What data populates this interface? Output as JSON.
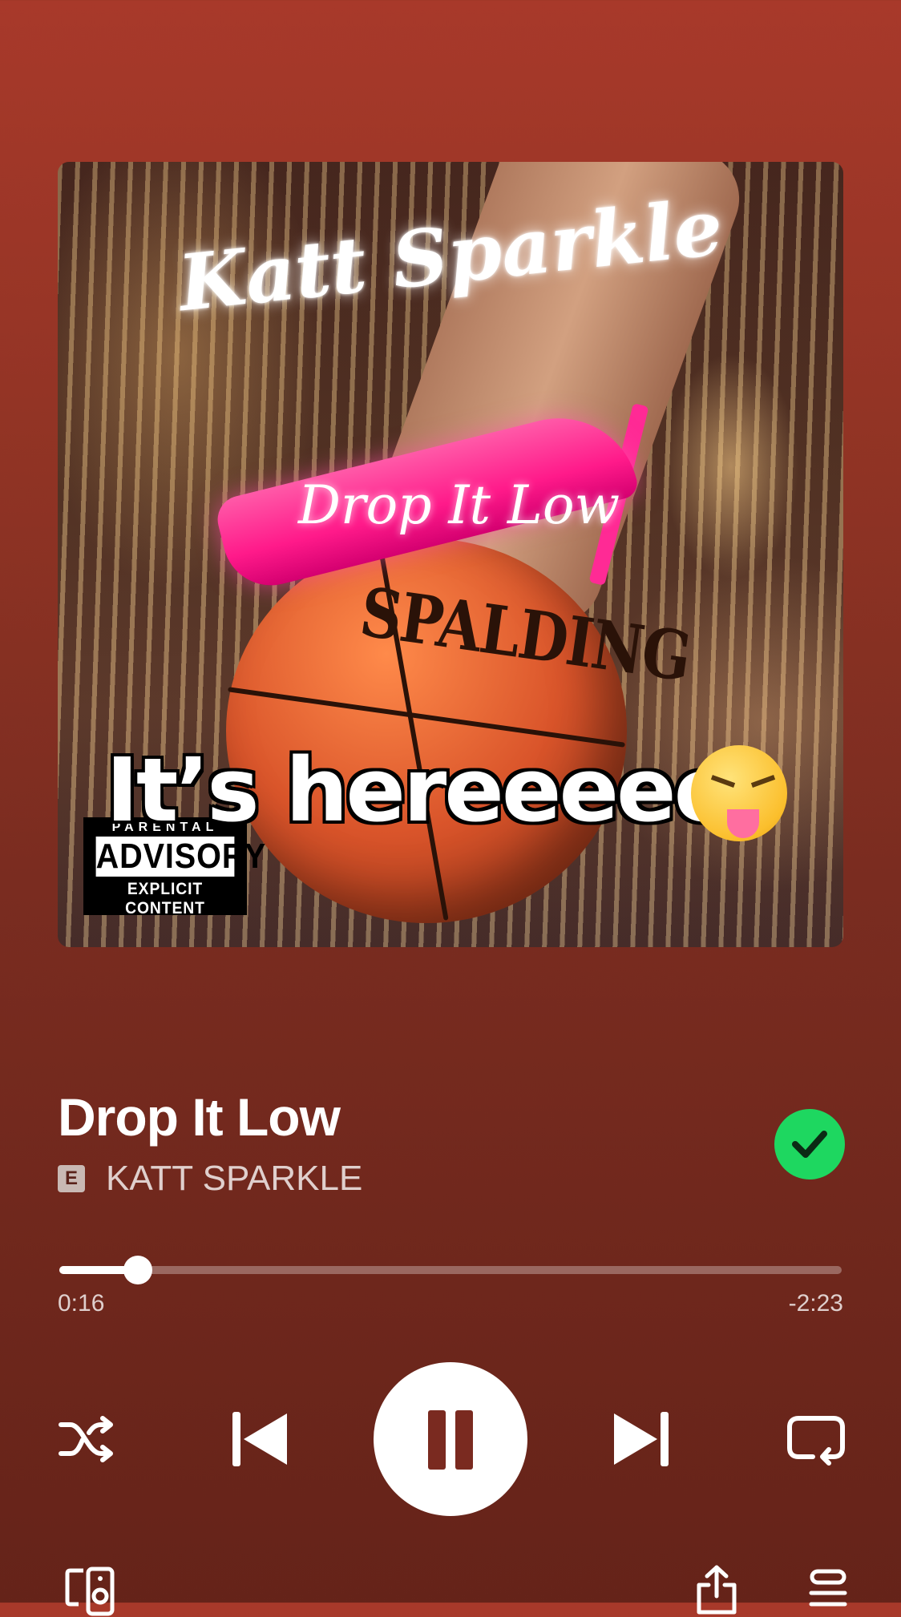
{
  "header": {
    "title": "",
    "back_icon": "chevron-down-icon"
  },
  "album_art": {
    "artist_lettering": "Katt Sparkle",
    "song_lettering": "Drop It Low",
    "ball_brand": "SPALDING",
    "overlay_caption": "It’s hereeeee",
    "overlay_emoji": "squinting-face-with-tongue",
    "advisory": {
      "top": "PARENTAL",
      "middle": "ADVISORY",
      "bottom": "EXPLICIT CONTENT"
    }
  },
  "track": {
    "title": "Drop It Low",
    "explicit_badge": "E",
    "artist": "KATT SPARKLE",
    "liked": true
  },
  "playback": {
    "elapsed": "0:16",
    "remaining": "-2:23",
    "progress_fraction": 0.1,
    "is_playing": true
  },
  "controls": {
    "shuffle_icon": "shuffle-icon",
    "previous_icon": "skip-previous-icon",
    "pause_icon": "pause-icon",
    "next_icon": "skip-next-icon",
    "repeat_icon": "repeat-icon",
    "devices_icon": "connect-devices-icon",
    "share_icon": "share-icon",
    "queue_icon": "queue-icon"
  },
  "colors": {
    "accent_green": "#1ed760",
    "background_top": "#a8392a",
    "background_bottom": "#652319"
  }
}
